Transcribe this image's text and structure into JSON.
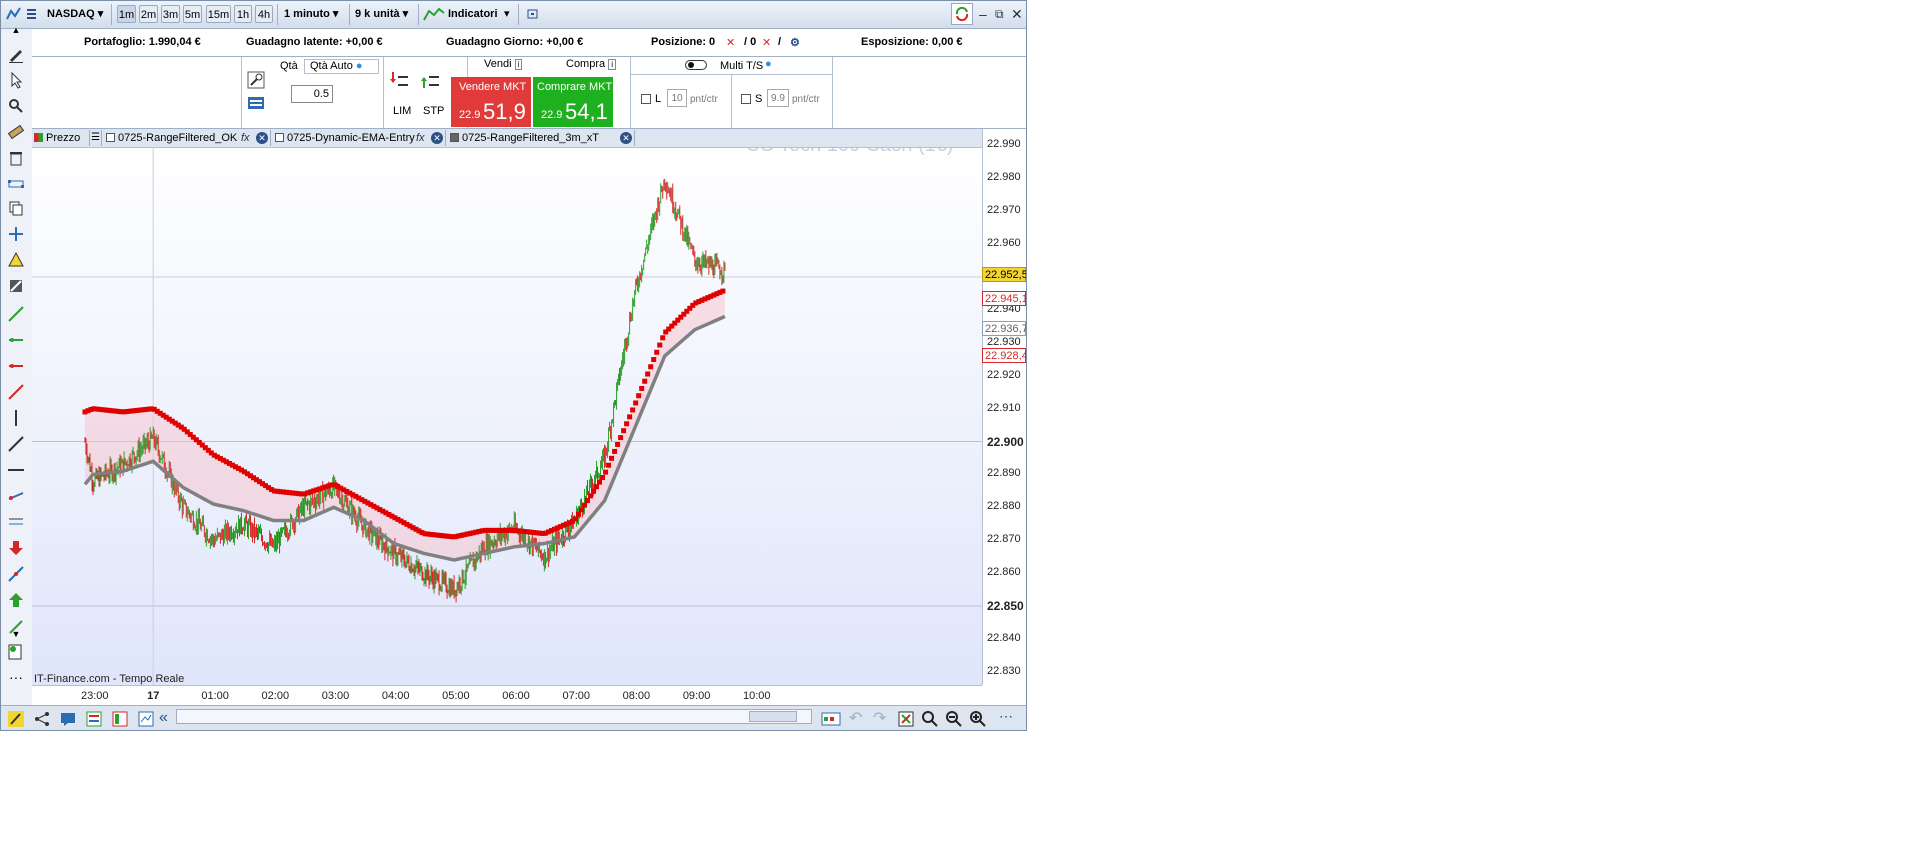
{
  "toolbar": {
    "instrument": "NASDAQ",
    "timeframes": [
      "1m",
      "2m",
      "3m",
      "5m",
      "15m",
      "1h",
      "4h"
    ],
    "interval": "1 minuto",
    "units": "9 k unità",
    "indicators": "Indicatori"
  },
  "info": {
    "portfolio": "Portafoglio: 1.990,04 €",
    "latent_gain": "Guadagno latente: +0,00 €",
    "day_gain": "Guadagno Giorno: +0,00 €",
    "position_label": "Posizione: 0",
    "position_sep": "/ 0",
    "position_slash": "/",
    "exposure": "Esposizione: 0,00 €"
  },
  "order": {
    "qty_label": "Qtà",
    "qty_auto_label": "Qtà Auto",
    "qty_value": "0.5",
    "lim_label": "LIM",
    "stp_label": "STP",
    "sell_header": "Vendi",
    "buy_header": "Compra",
    "sell_label": "Vendere MKT",
    "buy_label": "Comprare MKT",
    "sell_small": "22.9",
    "sell_big": "51,9",
    "buy_small": "22.9",
    "buy_big": "54,1",
    "multi_ts": "Multi T/S",
    "l_label": "L",
    "l_value": "10",
    "l_unit": "pnt/ctr",
    "s_label": "S",
    "s_value": "9.9",
    "s_unit": "pnt/ctr"
  },
  "tabs": [
    {
      "label": "Prezzo"
    },
    {
      "label": "0725-RangeFiltered_OK"
    },
    {
      "label": "0725-Dynamic-EMA-Entry"
    },
    {
      "label": "0725-RangeFiltered_3m_xT"
    }
  ],
  "chart": {
    "watermark": "US Tech 100 Cash (1€)",
    "source": "IT-Finance.com - Tempo Reale",
    "price_boxes": {
      "current": "22.952,5",
      "upper": "22.945,1",
      "lower": "22.936,7",
      "bottom": "22.928,4"
    },
    "colors": {
      "up": "#2ca02c",
      "down": "#d62728",
      "line_red": "#e00000",
      "line_gray": "#808080",
      "fill": "#f5c6d0",
      "current_bg": "#f3d531"
    }
  },
  "chart_data": {
    "type": "line",
    "y_ticks": [
      "22.990",
      "22.980",
      "22.970",
      "22.960",
      "22.950",
      "22.940",
      "22.930",
      "22.920",
      "22.910",
      "22.900",
      "22.890",
      "22.880",
      "22.870",
      "22.860",
      "22.850",
      "22.840",
      "22.830"
    ],
    "x_ticks": [
      "23:00",
      "17",
      "01:00",
      "02:00",
      "03:00",
      "04:00",
      "05:00",
      "06:00",
      "07:00",
      "08:00",
      "09:00",
      "10:00"
    ],
    "ylim": [
      22826,
      22995
    ],
    "x": [
      "22:52",
      "23:00",
      "23:30",
      "00:00",
      "00:30",
      "01:00",
      "01:30",
      "02:00",
      "02:30",
      "03:00",
      "03:30",
      "04:00",
      "04:30",
      "05:00",
      "05:30",
      "06:00",
      "06:30",
      "07:00",
      "07:30",
      "08:00",
      "08:30",
      "09:00",
      "09:30"
    ],
    "price": [
      22900,
      22888,
      22893,
      22901,
      22880,
      22870,
      22875,
      22868,
      22880,
      22886,
      22874,
      22866,
      22860,
      22855,
      22868,
      22874,
      22865,
      22876,
      22895,
      22945,
      22980,
      22955,
      22952
    ],
    "series": [
      {
        "name": "0725-RangeFiltered_OK",
        "values": [
          22909,
          22910,
          22909,
          22910,
          22904,
          22896,
          22891,
          22885,
          22884,
          22887,
          22882,
          22877,
          22872,
          22871,
          22873,
          22873,
          22872,
          22876,
          22890,
          22911,
          22933,
          22942,
          22946
        ]
      },
      {
        "name": "0725-Dynamic-EMA-Entry",
        "values": [
          22887,
          22890,
          22891,
          22894,
          22886,
          22881,
          22879,
          22876,
          22876,
          22880,
          22876,
          22869,
          22866,
          22864,
          22866,
          22868,
          22869,
          22871,
          22882,
          22904,
          22926,
          22934,
          22938
        ]
      }
    ]
  }
}
